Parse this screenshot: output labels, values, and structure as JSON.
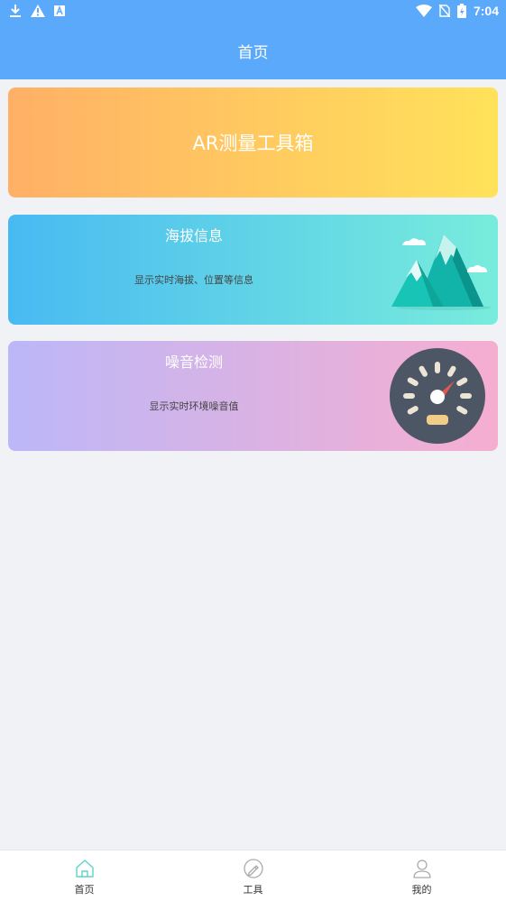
{
  "status_bar": {
    "time": "7:04",
    "left_icons": [
      "download-icon",
      "warning-icon",
      "text-a-icon"
    ],
    "right_icons": [
      "wifi-icon",
      "no-sim-icon",
      "battery-icon"
    ]
  },
  "header": {
    "title": "首页"
  },
  "cards": [
    {
      "title": "AR测量工具箱"
    },
    {
      "title": "海拔信息",
      "description": "显示实时海拔、位置等信息",
      "icon": "mountain-icon"
    },
    {
      "title": "噪音检测",
      "description": "显示实时环境噪音值",
      "icon": "gauge-icon"
    }
  ],
  "bottom_nav": [
    {
      "label": "首页",
      "icon": "home-icon",
      "active": true
    },
    {
      "label": "工具",
      "icon": "tools-icon",
      "active": false
    },
    {
      "label": "我的",
      "icon": "user-icon",
      "active": false
    }
  ],
  "colors": {
    "primary": "#5aa9fb",
    "background": "#f1f2f6",
    "active_nav": "#5fd3c8"
  }
}
